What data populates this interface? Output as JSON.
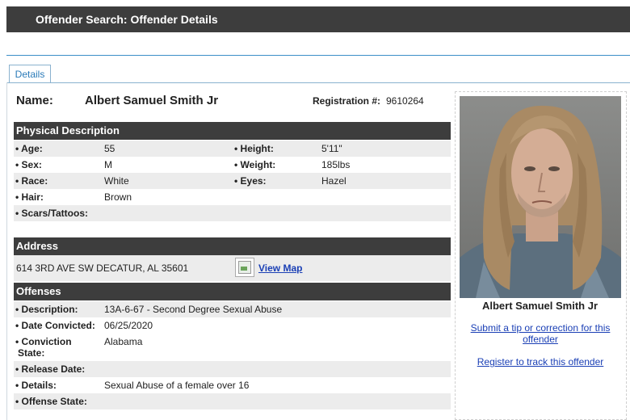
{
  "header": {
    "title": "Offender Search: Offender Details"
  },
  "tabs": [
    {
      "label": "Details",
      "active": true
    }
  ],
  "offender": {
    "name_label": "Name:",
    "name": "Albert Samuel Smith Jr",
    "registration_label": "Registration #:",
    "registration_number": "9610264"
  },
  "physical": {
    "heading": "Physical Description",
    "age_label": "• Age:",
    "age": "55",
    "height_label": "• Height:",
    "height": "5'11\"",
    "sex_label": "• Sex:",
    "sex": "M",
    "weight_label": "• Weight:",
    "weight": "185lbs",
    "race_label": "• Race:",
    "race": "White",
    "eyes_label": "• Eyes:",
    "eyes": "Hazel",
    "hair_label": "• Hair:",
    "hair": "Brown",
    "scars_label": "• Scars/Tattoos:",
    "scars": ""
  },
  "address": {
    "heading": "Address",
    "line": "614 3RD AVE SW DECATUR, AL 35601",
    "map_link": "View Map"
  },
  "offenses": {
    "heading": "Offenses",
    "description_label": "• Description:",
    "description": "13A-6-67 - Second Degree Sexual Abuse",
    "date_convicted_label": "• Date Convicted:",
    "date_convicted": "06/25/2020",
    "conviction_state_label_1": "• Conviction",
    "conviction_state_label_2": "State:",
    "conviction_state": "Alabama",
    "release_date_label": "• Release Date:",
    "release_date": "",
    "details_label": "• Details:",
    "details": "Sexual Abuse of a female over 16",
    "offense_state_label": "• Offense State:",
    "offense_state": ""
  },
  "sidebar": {
    "photo_caption": "Albert Samuel Smith Jr",
    "tip_link_1": "Submit a tip or correction for this",
    "tip_link_2": "offender",
    "track_link": "Register to track this offender"
  },
  "colors": {
    "header_bg": "#3d3d3d",
    "link": "#1a3fb5",
    "tab_text": "#2a7ab8",
    "row_shade": "#ececec"
  }
}
